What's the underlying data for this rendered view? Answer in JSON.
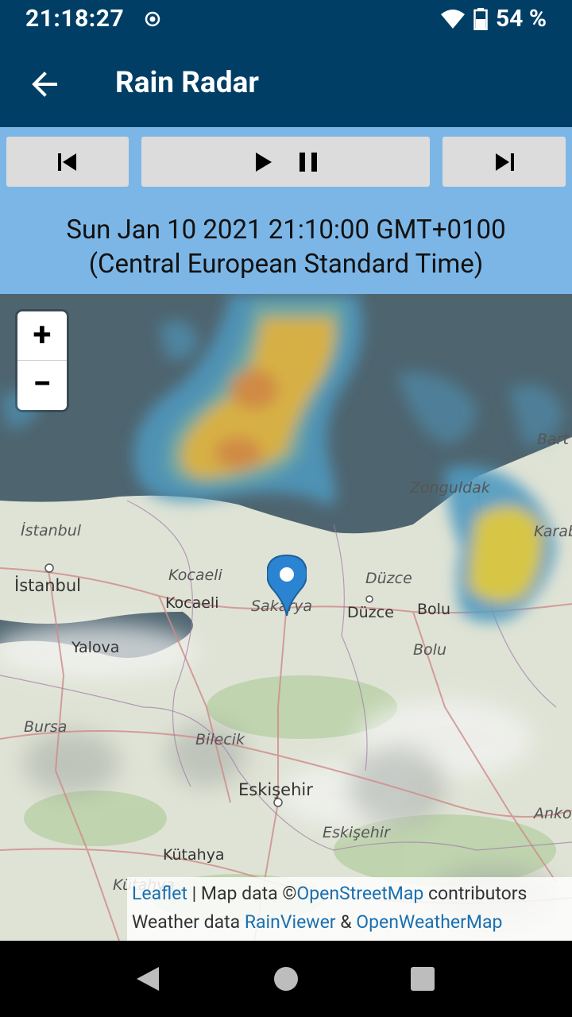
{
  "status_bar": {
    "time": "21:18:27",
    "battery": "54 %"
  },
  "app_bar": {
    "title": "Rain Radar"
  },
  "playback": {
    "timestamp_line1": "Sun Jan 10 2021 21:10:00 GMT+0100",
    "timestamp_line2": "(Central European Standard Time)"
  },
  "map": {
    "zoom_in_label": "+",
    "zoom_out_label": "−",
    "labels": {
      "istanbul_it": "İstanbul",
      "istanbul": "İstanbul",
      "kocaeli_it": "Kocaeli",
      "kocaeli": "Kocaeli",
      "sakarya": "Sakarya",
      "duzce_it": "Düzce",
      "duzce": "Düzce",
      "bolu": "Bolu",
      "bolu_it": "Bolu",
      "zonguldak": "Zonguldak",
      "bartin": "Bart",
      "karabuk": "Karab",
      "yalova": "Yalova",
      "bursa": "Bursa",
      "bilecik": "Bilecik",
      "eskisehir": "Eskişehir",
      "eskisehir_it": "Eskişehir",
      "kutahya": "Kütahya",
      "kutahya_it": "Kütahya",
      "ankara": "Anko"
    }
  },
  "attribution": {
    "leaflet": "Leaflet",
    "sep1": " | Map data ©",
    "osm": "OpenStreetMap",
    "contributors": " contributors",
    "weather": "Weather data ",
    "rainviewer": "RainViewer",
    "amp": " & ",
    "owm": "OpenWeatherMap"
  },
  "colors": {
    "header": "#003e66",
    "controls_bg": "#7cb6e6",
    "button_bg": "#dcdcdc",
    "marker": "#2a84d2",
    "link": "#1a6fb0"
  }
}
